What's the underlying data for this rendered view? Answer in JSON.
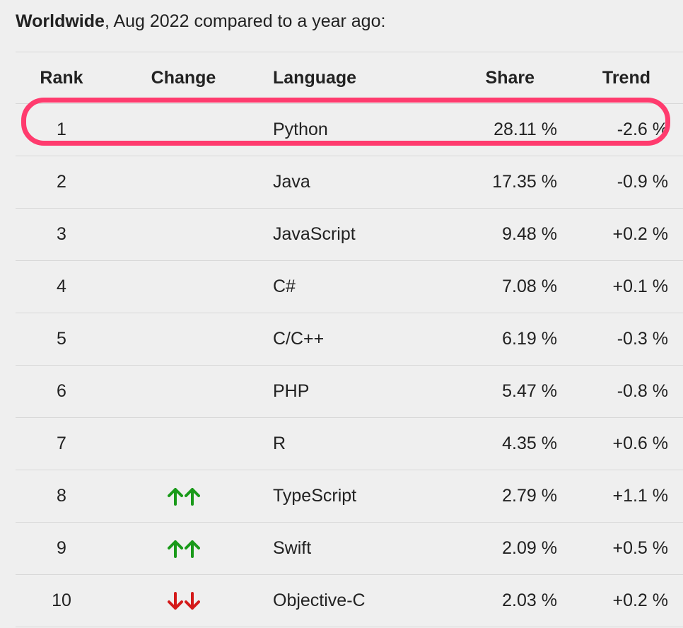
{
  "caption": {
    "bold": "Worldwide",
    "rest": ", Aug 2022 compared to a year ago:"
  },
  "headers": {
    "rank": "Rank",
    "change": "Change",
    "language": "Language",
    "share": "Share",
    "trend": "Trend"
  },
  "rows": [
    {
      "rank": "1",
      "change": "",
      "language": "Python",
      "share": "28.11 %",
      "trend": "-2.6 %"
    },
    {
      "rank": "2",
      "change": "",
      "language": "Java",
      "share": "17.35 %",
      "trend": "-0.9 %"
    },
    {
      "rank": "3",
      "change": "",
      "language": "JavaScript",
      "share": "9.48 %",
      "trend": "+0.2 %"
    },
    {
      "rank": "4",
      "change": "",
      "language": "C#",
      "share": "7.08 %",
      "trend": "+0.1 %"
    },
    {
      "rank": "5",
      "change": "",
      "language": "C/C++",
      "share": "6.19 %",
      "trend": "-0.3 %"
    },
    {
      "rank": "6",
      "change": "",
      "language": "PHP",
      "share": "5.47 %",
      "trend": "-0.8 %"
    },
    {
      "rank": "7",
      "change": "",
      "language": "R",
      "share": "4.35 %",
      "trend": "+0.6 %"
    },
    {
      "rank": "8",
      "change": "double-up-arrow-icon",
      "language": "TypeScript",
      "share": "2.79 %",
      "trend": "+1.1 %"
    },
    {
      "rank": "9",
      "change": "double-up-arrow-icon",
      "language": "Swift",
      "share": "2.09 %",
      "trend": "+0.5 %"
    },
    {
      "rank": "10",
      "change": "double-down-arrow-icon",
      "language": "Objective-C",
      "share": "2.03 %",
      "trend": "+0.2 %"
    }
  ],
  "colors": {
    "highlight": "#ff3b6e",
    "up_arrow": "#1a9a1a",
    "down_arrow": "#d41a1a",
    "background": "#efefef",
    "row_divider": "#d8d8d8"
  }
}
